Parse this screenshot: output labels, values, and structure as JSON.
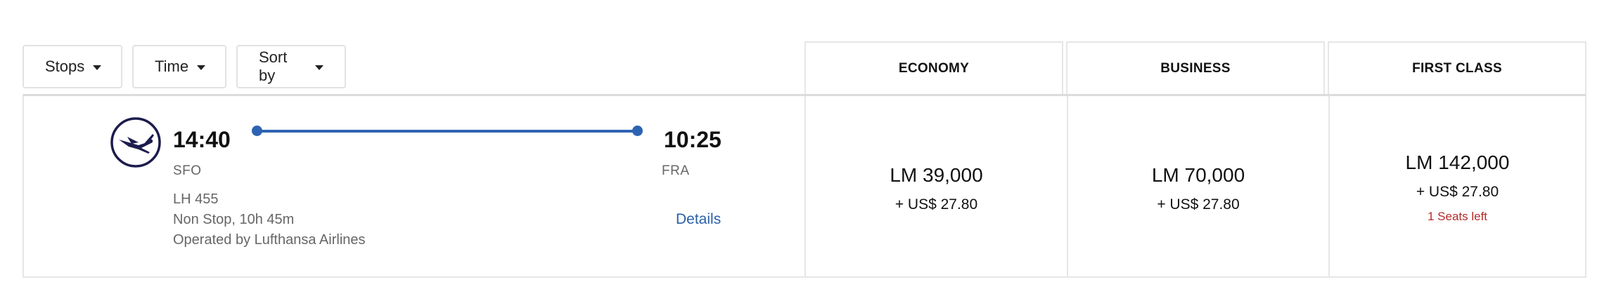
{
  "filters": {
    "stops_label": "Stops",
    "time_label": "Time",
    "sort_label": "Sort by"
  },
  "cabins": {
    "economy": "ECONOMY",
    "business": "BUSINESS",
    "first": "FIRST CLASS"
  },
  "flight": {
    "airline_logo_icon": "lufthansa-crane-icon",
    "departure_time": "14:40",
    "departure_airport": "SFO",
    "arrival_time": "10:25",
    "arrival_airport": "FRA",
    "flight_number": "LH 455",
    "duration": "Non Stop, 10h 45m",
    "operator": "Operated by Lufthansa Airlines",
    "details_label": "Details"
  },
  "fares": {
    "economy": {
      "miles": "LM 39,000",
      "cash": "+ US$ 27.80"
    },
    "business": {
      "miles": "LM 70,000",
      "cash": "+ US$ 27.80"
    },
    "first": {
      "miles": "LM 142,000",
      "cash": "+ US$ 27.80",
      "seats_left": "1 Seats left"
    }
  },
  "colors": {
    "route_blue": "#2e63b3",
    "link_blue": "#2a60a8",
    "alert_red": "#b52a2a",
    "logo_navy": "#1c1c4e"
  }
}
